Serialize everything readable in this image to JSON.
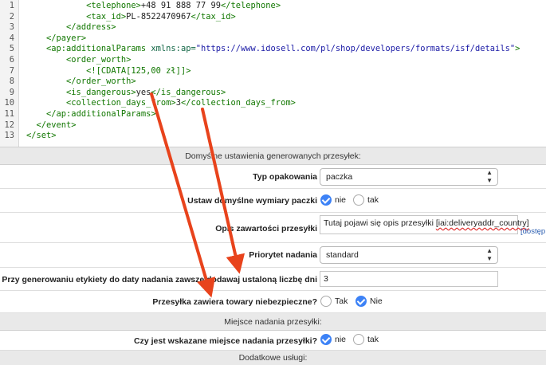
{
  "editor": {
    "lines": [
      {
        "num": "1",
        "indent": "            ",
        "parts": [
          [
            "tag",
            "<telephone>"
          ],
          [
            "txt",
            "+48 91 888 77 99"
          ],
          [
            "tag",
            "</telephone>"
          ]
        ]
      },
      {
        "num": "2",
        "indent": "            ",
        "parts": [
          [
            "tag",
            "<tax_id>"
          ],
          [
            "txt",
            "PL-8522470967"
          ],
          [
            "tag",
            "</tax_id>"
          ]
        ]
      },
      {
        "num": "3",
        "indent": "        ",
        "parts": [
          [
            "tag",
            "</address>"
          ]
        ]
      },
      {
        "num": "4",
        "indent": "    ",
        "parts": [
          [
            "tag",
            "</payer>"
          ]
        ]
      },
      {
        "num": "5",
        "indent": "    ",
        "parts": [
          [
            "tag",
            "<ap:additionalParams "
          ],
          [
            "attr",
            "xmlns:ap="
          ],
          [
            "str",
            "\"https://www.idosell.com/pl/shop/developers/formats/isf/details\""
          ],
          [
            "tag",
            ">"
          ]
        ]
      },
      {
        "num": "6",
        "indent": "        ",
        "parts": [
          [
            "tag",
            "<order_worth>"
          ]
        ]
      },
      {
        "num": "7",
        "indent": "            ",
        "parts": [
          [
            "cdata",
            "<![CDATA[125,00 zł]]>"
          ]
        ]
      },
      {
        "num": "8",
        "indent": "        ",
        "parts": [
          [
            "tag",
            "</order_worth>"
          ]
        ]
      },
      {
        "num": "9",
        "indent": "        ",
        "parts": [
          [
            "tag",
            "<is_dangerous>"
          ],
          [
            "txt",
            "yes"
          ],
          [
            "tag",
            "</is_dangerous>"
          ]
        ]
      },
      {
        "num": "10",
        "indent": "        ",
        "parts": [
          [
            "tag",
            "<collection_days_from>"
          ],
          [
            "txt",
            "3"
          ],
          [
            "tag",
            "</collection_days_from>"
          ]
        ]
      },
      {
        "num": "11",
        "indent": "    ",
        "parts": [
          [
            "tag",
            "</ap:additionalParams>"
          ]
        ]
      },
      {
        "num": "12",
        "indent": "  ",
        "parts": [
          [
            "tag",
            "</event>"
          ]
        ]
      },
      {
        "num": "13",
        "indent": "",
        "parts": [
          [
            "tag",
            "</set>"
          ]
        ]
      }
    ]
  },
  "form": {
    "header_default": "Domyślne ustawienia generowanych przesyłek:",
    "package_type_label": "Typ opakowania",
    "package_type_value": "paczka",
    "default_dims_label": "Ustaw domyślne wymiary paczki",
    "opt_no": "nie",
    "opt_yes": "tak",
    "content_desc_label": "Opis zawartości przesyłki",
    "content_desc_pre": "Tutaj pojawi się opis przesyłki ",
    "content_desc_var": "[iai:deliveryaddr_country]",
    "available_link": "[dostęp",
    "priority_label": "Priorytet nadania",
    "priority_value": "standard",
    "days_label": "Przy generowaniu etykiety do daty nadania zawsze dodawaj ustaloną liczbę dni",
    "days_value": "3",
    "dangerous_label": "Przesyłka zawiera towary niebezpieczne?",
    "opt_tak": "Tak",
    "opt_nie": "Nie",
    "header_place": "Miejsce nadania przesyłki:",
    "place_label": "Czy jest wskazane miejsce nadania przesyłki?",
    "header_extra": "Dodatkowe usługi:"
  },
  "colors": {
    "arrow": "#e8431c",
    "radio_checked": "#3d82f6"
  }
}
